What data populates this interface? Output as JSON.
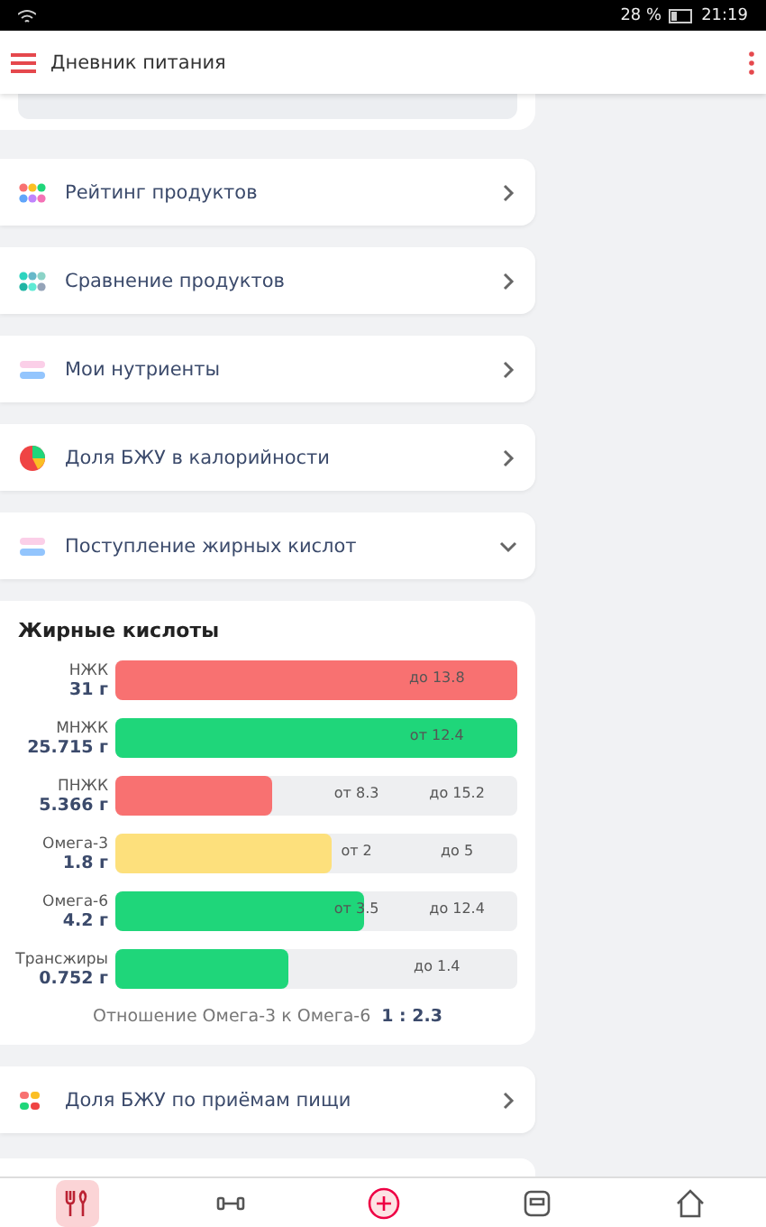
{
  "status_bar": {
    "battery": "28 %",
    "time": "21:19"
  },
  "app_bar": {
    "title": "Дневник питания"
  },
  "menu_items": [
    {
      "label": "Рейтинг продуктов",
      "expanded": false
    },
    {
      "label": "Сравнение продуктов",
      "expanded": false
    },
    {
      "label": "Мои нутриенты",
      "expanded": false
    },
    {
      "label": "Доля БЖУ в калорийности",
      "expanded": false
    },
    {
      "label": "Поступление жирных кислот",
      "expanded": true
    }
  ],
  "fat_card": {
    "title": "Жирные кислоты",
    "rows": [
      {
        "name": "НЖК",
        "amount": "31 г",
        "level": 1,
        "color": "#f87171",
        "marks": [
          "до 13.8"
        ]
      },
      {
        "name": "МНЖК",
        "amount": "25.715 г",
        "level": 1,
        "color": "#1fd67a",
        "marks": [
          "от 12.4"
        ]
      },
      {
        "name": "ПНЖК",
        "amount": "5.366 г",
        "level": 0.39,
        "color": "#f87171",
        "marks": [
          "от 8.3",
          "до 15.2"
        ]
      },
      {
        "name": "Омега-3",
        "amount": "1.8 г",
        "level": 0.54,
        "color": "#fde07c",
        "marks": [
          "от 2",
          "до 5"
        ]
      },
      {
        "name": "Омега-6",
        "amount": "4.2 г",
        "level": 0.62,
        "color": "#1fd67a",
        "marks": [
          "от 3.5",
          "до 12.4"
        ]
      },
      {
        "name": "Трансжиры",
        "amount": "0.752 г",
        "level": 0.43,
        "color": "#1fd67a",
        "marks": [
          "до 1.4"
        ]
      }
    ],
    "ratio_label": "Отношение Омега-3 к Омега-6",
    "ratio_value": "1 : 2.3"
  },
  "after_items": [
    {
      "label": "Доля БЖУ по приёмам пищи",
      "expanded": false
    }
  ],
  "bottom_nav": [
    {
      "kind": "food",
      "selected": true
    },
    {
      "kind": "workout",
      "selected": false
    },
    {
      "kind": "add",
      "selected": false
    },
    {
      "kind": "scale",
      "selected": false
    },
    {
      "kind": "home",
      "selected": false
    }
  ]
}
